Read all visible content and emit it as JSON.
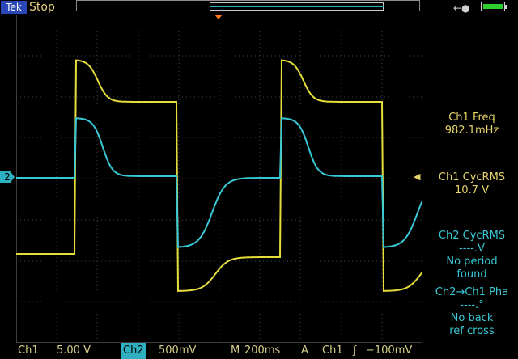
{
  "header": {
    "brand": "Tek",
    "status": "Stop"
  },
  "markers": {
    "ch2_marker": "2"
  },
  "measurements": [
    {
      "title": "Ch1 Freq",
      "lines": [
        "982.1mHz"
      ]
    },
    {
      "title": "Ch1 CycRMS",
      "lines": [
        "10.7 V"
      ]
    },
    {
      "title": "Ch2 CycRMS",
      "lines": [
        "----.V",
        "No period",
        "found"
      ]
    },
    {
      "title": "Ch2→Ch1 Pha",
      "lines": [
        "----.°",
        "No back",
        "ref cross"
      ]
    }
  ],
  "bottom": {
    "ch1_label": "Ch1",
    "ch1_scale": "5.00 V",
    "ch2_label": "Ch2",
    "ch2_scale": "500mV",
    "m_label": "M",
    "time_scale": "200ms",
    "a_label": "A",
    "trig_source": "Ch1",
    "trig_symbol": "ʃ",
    "trig_level": "−100mV"
  },
  "colors": {
    "ch1": "#e6dc3c",
    "ch2": "#39c9d6",
    "grid": "#7a7a7a"
  },
  "icons": {
    "power": "plug-icon",
    "battery": "battery-icon"
  }
}
